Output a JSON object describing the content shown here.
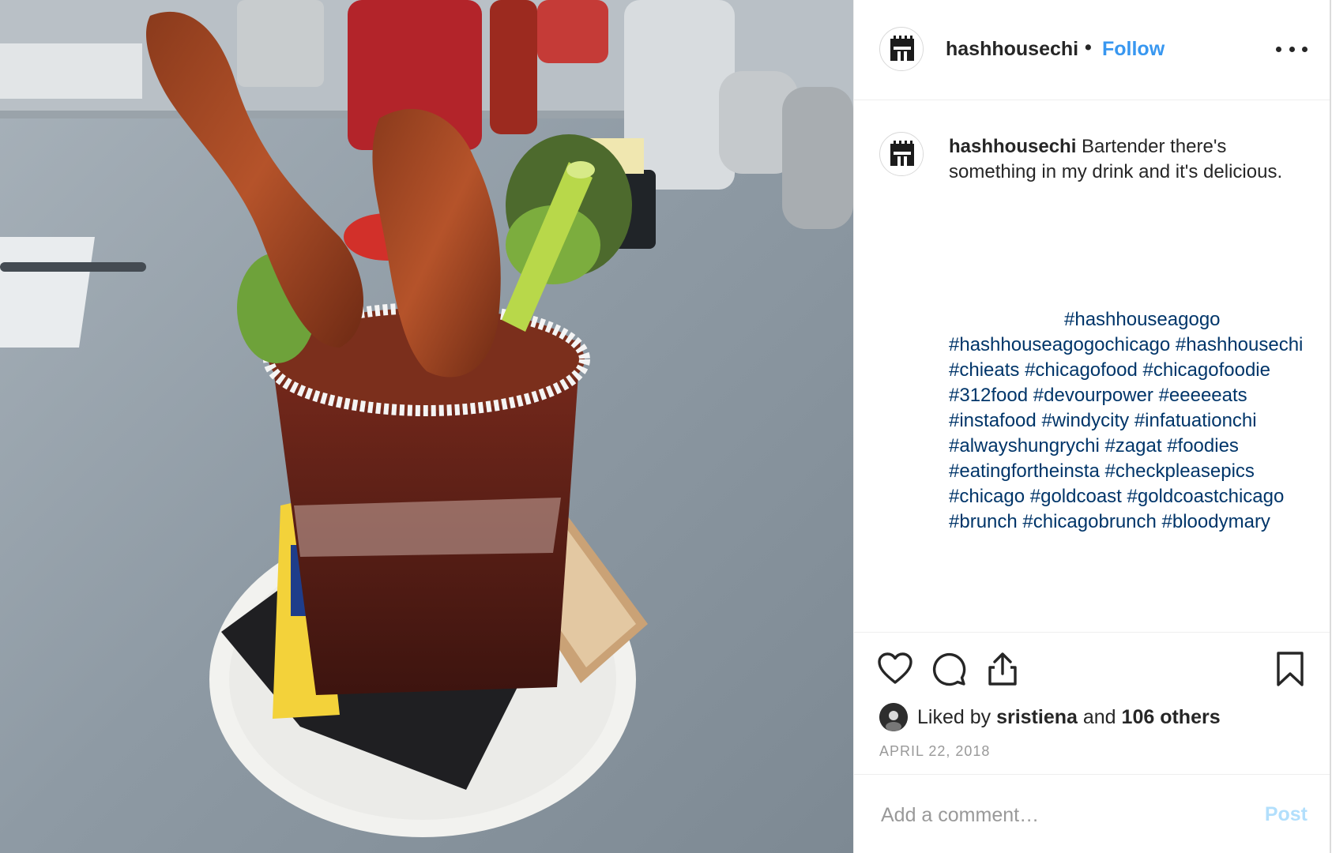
{
  "post": {
    "username": "hashhousechi",
    "follow_label": "Follow",
    "separator": "•",
    "caption_user": "hashhousechi",
    "caption_text": "Bartender there's something in my drink and it's delicious.",
    "hashtags": [
      "#hashhouseagogo",
      "#hashhouseagogochicago",
      "#hashhousechi",
      "#chieats",
      "#chicagofood",
      "#chicagofoodie",
      "#312food",
      "#devourpower",
      "#eeeeeats",
      "#instafood",
      "#windycity",
      "#infatuationchi",
      "#alwayshungrychi",
      "#zagat",
      "#foodies",
      "#eatingfortheinsta",
      "#checkpleasepics",
      "#chicago",
      "#goldcoast",
      "#goldcoastchicago",
      "#brunch",
      "#chicagobrunch",
      "#bloodymary"
    ],
    "likes": {
      "prefix": "Liked by",
      "user": "sristiena",
      "conjunction": "and",
      "others": "106 others"
    },
    "date": "APRIL 22, 2018",
    "comment_placeholder": "Add a comment…",
    "post_label": "Post"
  },
  "icons": {
    "more": "more-options-icon",
    "like": "heart-icon",
    "comment": "comment-bubble-icon",
    "share": "share-icon",
    "save": "bookmark-icon"
  },
  "colors": {
    "link_blue": "#3897f0",
    "hashtag_blue": "#003569",
    "post_disabled": "#b2dffc",
    "meta_gray": "#999999"
  }
}
